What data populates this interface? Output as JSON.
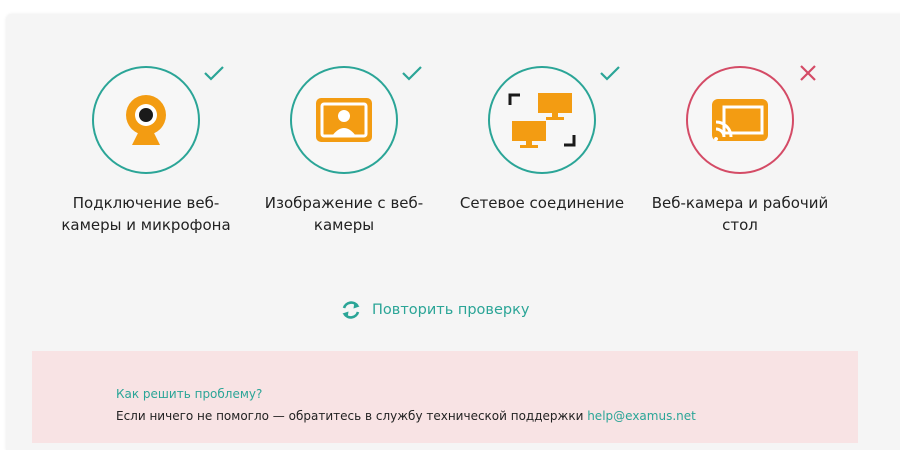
{
  "checks": [
    {
      "label": "Подключение веб-камеры и микрофона",
      "status": "ok",
      "icon": "webcam-icon"
    },
    {
      "label": "Изображение с веб-камеры",
      "status": "ok",
      "icon": "user-portrait-icon"
    },
    {
      "label": "Сетевое соединение",
      "status": "ok",
      "icon": "network-icon"
    },
    {
      "label": "Веб-камера и рабочий стол",
      "status": "error",
      "icon": "screen-cast-icon"
    }
  ],
  "retry": {
    "label": "Повторить проверку"
  },
  "help": {
    "title": "Как решить проблему?",
    "text": "Если ничего не помогло — обратитесь в службу технической поддержки ",
    "email": "help@examus.net"
  },
  "colors": {
    "accent": "#2ba597",
    "error": "#d44b66",
    "icon": "#f39c12",
    "help_bg": "#f8e3e4"
  }
}
